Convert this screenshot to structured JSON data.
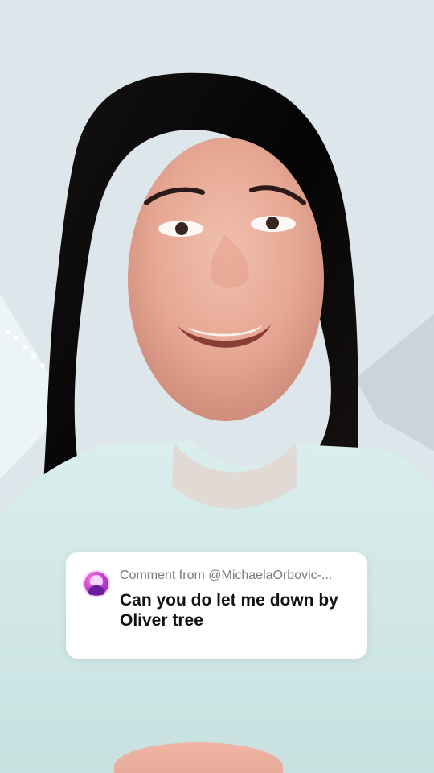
{
  "comment": {
    "prefix": "Comment from",
    "username": "@MichaelaOrbovic-...",
    "text": "Can you do let me down by Oliver tree"
  }
}
